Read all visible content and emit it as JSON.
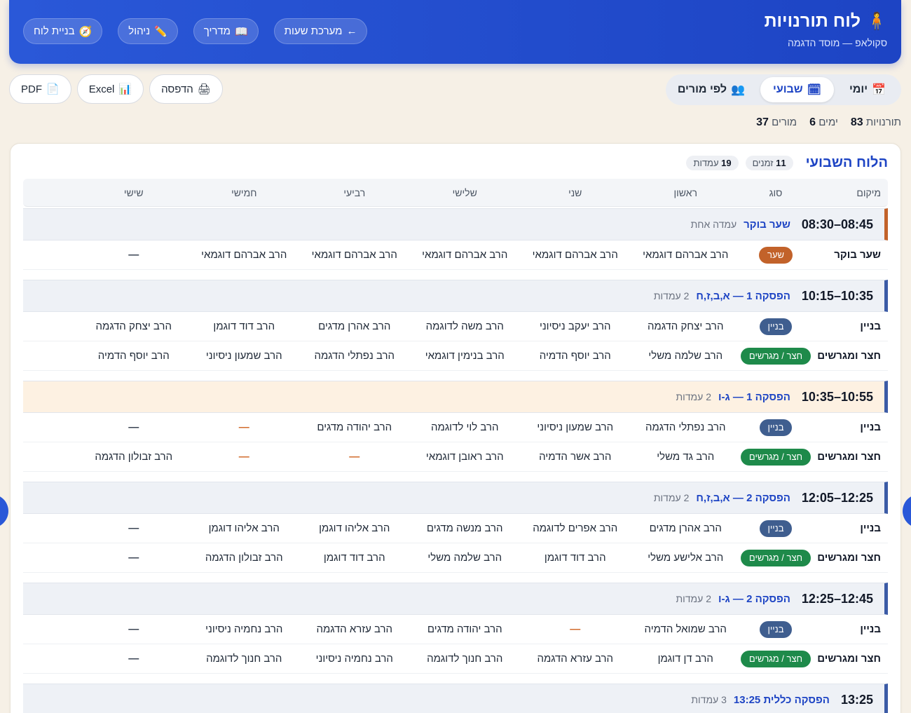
{
  "header": {
    "title": "לוח תורנויות",
    "subtitle": "סקולאפ — מוסד הדגמה",
    "icon": "person-icon",
    "nav": [
      {
        "key": "build",
        "icon": "🧭",
        "label": "בניית לוח"
      },
      {
        "key": "manage",
        "icon": "✏️",
        "label": "ניהול"
      },
      {
        "key": "guide",
        "icon": "📖",
        "label": "מדריך"
      },
      {
        "key": "schedule",
        "icon": "←",
        "label": "מערכת שעות"
      }
    ]
  },
  "view_toggle": [
    {
      "icon": "📅",
      "label": "יומי",
      "active": false
    },
    {
      "icon": "🗓",
      "label": "שבועי",
      "active": true
    },
    {
      "icon": "👥",
      "label": "לפי מורים",
      "active": false
    }
  ],
  "exports": [
    {
      "icon": "📄",
      "label": "PDF"
    },
    {
      "icon": "📊",
      "label": "Excel"
    },
    {
      "icon": "🖨",
      "label": "הדפסה"
    }
  ],
  "stats": [
    {
      "label": "תורנויות",
      "value": "83"
    },
    {
      "label": "ימים",
      "value": "6"
    },
    {
      "label": "מורים",
      "value": "37"
    }
  ],
  "board": {
    "title": "הלוח השבועי",
    "pills": [
      {
        "value": "11",
        "label": "זמנים"
      },
      {
        "value": "19",
        "label": "עמדות"
      }
    ],
    "columns": {
      "location": "מיקום",
      "type": "סוג",
      "days": [
        "ראשון",
        "שני",
        "שלישי",
        "רביעי",
        "חמישי",
        "שישי"
      ]
    },
    "slots": [
      {
        "time": "08:30–08:45",
        "name": "שער בוקר",
        "count": "עמדה אחת",
        "style": "first",
        "rows": [
          {
            "location": "שער בוקר",
            "type": "שער",
            "tag": "gate",
            "cells": [
              "הרב אברהם דוגמאי",
              "הרב אברהם דוגמאי",
              "הרב אברהם דוגמאי",
              "הרב אברהם דוגמאי",
              "הרב אברהם דוגמאי",
              "—"
            ]
          }
        ]
      },
      {
        "time": "10:15–10:35",
        "name": "הפסקה 1 — א,ב,ז,ח",
        "count": "2 עמדות",
        "style": "",
        "rows": [
          {
            "location": "בניין",
            "type": "בניין",
            "tag": "building",
            "cells": [
              "הרב יצחק הדגמה",
              "הרב יעקב ניסיוני",
              "הרב משה לדוגמה",
              "הרב אהרן מדגים",
              "הרב דוד דוגמן",
              "הרב יצחק הדגמה"
            ]
          },
          {
            "location": "חצר ומגרשים",
            "type": "חצר / מגרשים",
            "tag": "yard",
            "cells": [
              "הרב שלמה משלי",
              "הרב יוסף הדמיה",
              "הרב בנימין דוגמאי",
              "הרב נפתלי הדגמה",
              "הרב שמעון ניסיוני",
              "הרב יוסף הדמיה"
            ]
          }
        ]
      },
      {
        "time": "10:35–10:55",
        "name": "הפסקה 1 — ג-ו",
        "count": "2 עמדות",
        "style": "warm",
        "rows": [
          {
            "location": "בניין",
            "type": "בניין",
            "tag": "building",
            "cells": [
              "הרב נפתלי הדגמה",
              "הרב שמעון ניסיוני",
              "הרב לוי לדוגמה",
              "הרב יהודה מדגים",
              "—",
              "—"
            ]
          },
          {
            "location": "חצר ומגרשים",
            "type": "חצר / מגרשים",
            "tag": "yard",
            "cells": [
              "הרב גד משלי",
              "הרב אשר הדמיה",
              "הרב ראובן דוגמאי",
              "—",
              "—",
              "הרב זבולון הדגמה"
            ]
          }
        ]
      },
      {
        "time": "12:05–12:25",
        "name": "הפסקה 2 — א,ב,ז,ח",
        "count": "2 עמדות",
        "style": "",
        "rows": [
          {
            "location": "בניין",
            "type": "בניין",
            "tag": "building",
            "cells": [
              "הרב אהרן מדגים",
              "הרב אפרים לדוגמה",
              "הרב מנשה מדגים",
              "הרב אליהו דוגמן",
              "הרב אליהו דוגמן",
              "—"
            ]
          },
          {
            "location": "חצר ומגרשים",
            "type": "חצר / מגרשים",
            "tag": "yard",
            "cells": [
              "הרב אלישע משלי",
              "הרב דוד דוגמן",
              "הרב שלמה משלי",
              "הרב דוד דוגמן",
              "הרב זבולון הדגמה",
              "—"
            ]
          }
        ]
      },
      {
        "time": "12:25–12:45",
        "name": "הפסקה 2 — ג-ו",
        "count": "2 עמדות",
        "style": "",
        "rows": [
          {
            "location": "בניין",
            "type": "בניין",
            "tag": "building",
            "cells": [
              "הרב שמואל הדמיה",
              "—",
              "הרב יהודה מדגים",
              "הרב עזרא הדגמה",
              "הרב נחמיה ניסיוני",
              "—"
            ]
          },
          {
            "location": "חצר ומגרשים",
            "type": "חצר / מגרשים",
            "tag": "yard",
            "cells": [
              "הרב דן דוגמן",
              "הרב עזרא הדגמה",
              "הרב חנוך לדוגמה",
              "הרב נחמיה ניסיוני",
              "הרב חנוך לדוגמה",
              "—"
            ]
          }
        ]
      },
      {
        "time": "13:25",
        "name": "הפסקה כללית 13:25",
        "count": "3 עמדות",
        "style": "",
        "rows": []
      }
    ]
  }
}
